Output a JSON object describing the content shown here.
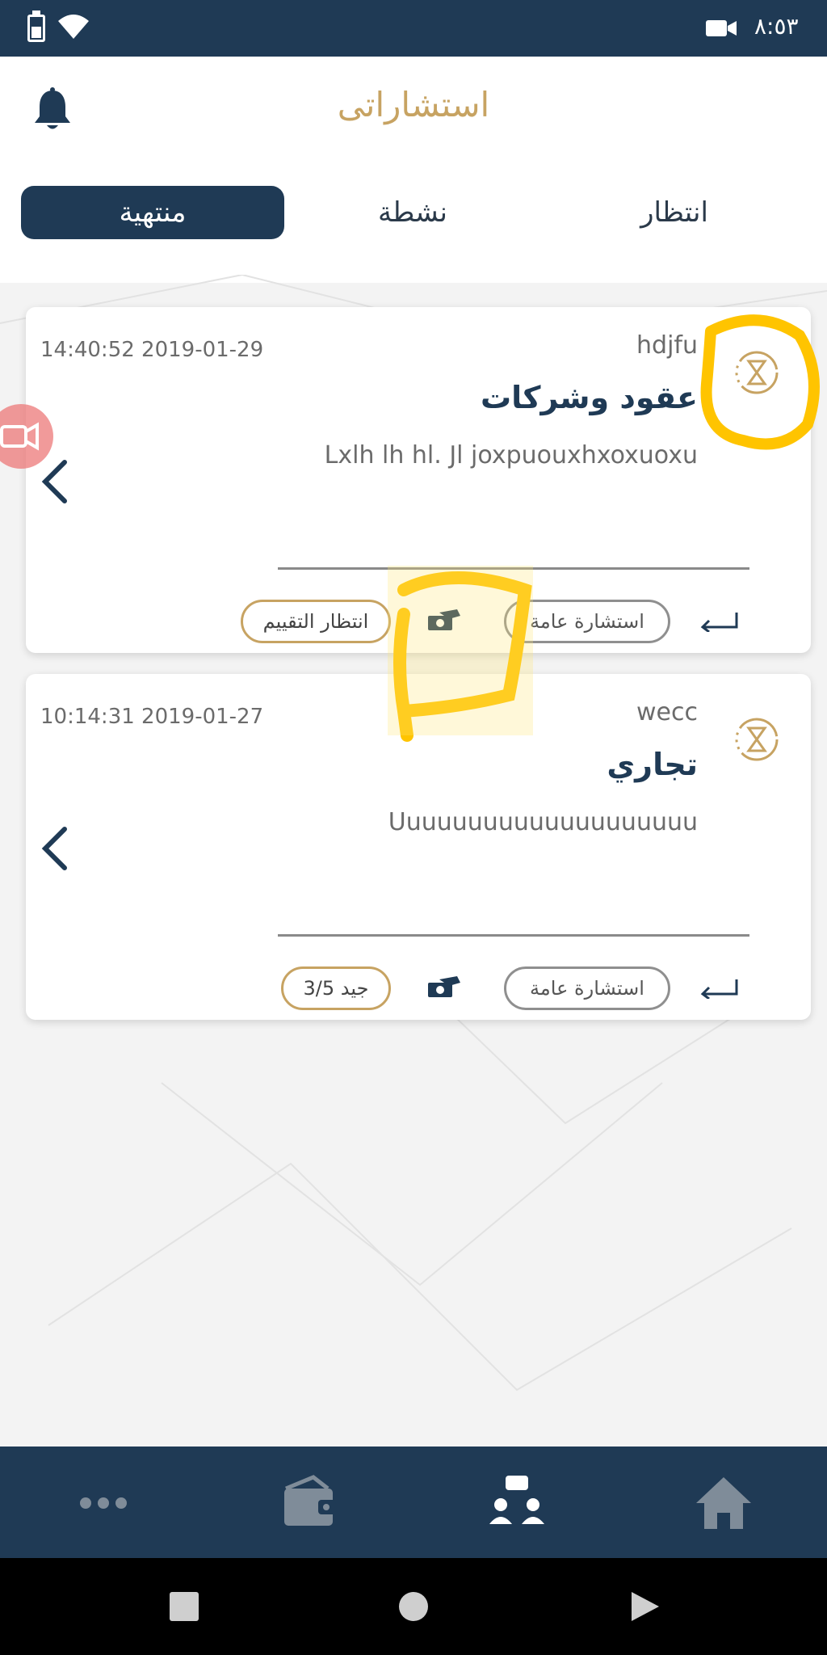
{
  "status_bar": {
    "time": "٨:٥٣"
  },
  "header": {
    "title": "استشاراتى",
    "tabs": [
      {
        "label": "انتظار",
        "active": false
      },
      {
        "label": "نشطة",
        "active": false
      },
      {
        "label": "منتهية",
        "active": true
      }
    ]
  },
  "cards": [
    {
      "date": "14:40:52 2019-01-29",
      "user": "hdjfu",
      "category": "عقود وشركات",
      "description": "Lxlh lh hl. Jl joxpuouxhxoxuoxu",
      "type_label": "استشارة عامة",
      "status_label": "انتظار التقييم"
    },
    {
      "date": "10:14:31 2019-01-27",
      "user": "wecc",
      "category": "تجاري",
      "description": "Uuuuuuuuuuuuuuuuuuuu",
      "type_label": "استشارة عامة",
      "status_label": "3/5 جيد"
    }
  ],
  "colors": {
    "navy": "#1f3a55",
    "gold": "#c7a362",
    "annotation_yellow": "#ffc400"
  },
  "icons": {
    "bell": "bell-icon",
    "hourglass": "hourglass-icon",
    "chevron": "chevron-left-icon",
    "money": "money-hand-icon",
    "reply": "reply-arrow-icon",
    "video": "video-call-icon",
    "nav": [
      "more-icon",
      "wallet-icon",
      "consultations-icon",
      "home-icon"
    ]
  }
}
